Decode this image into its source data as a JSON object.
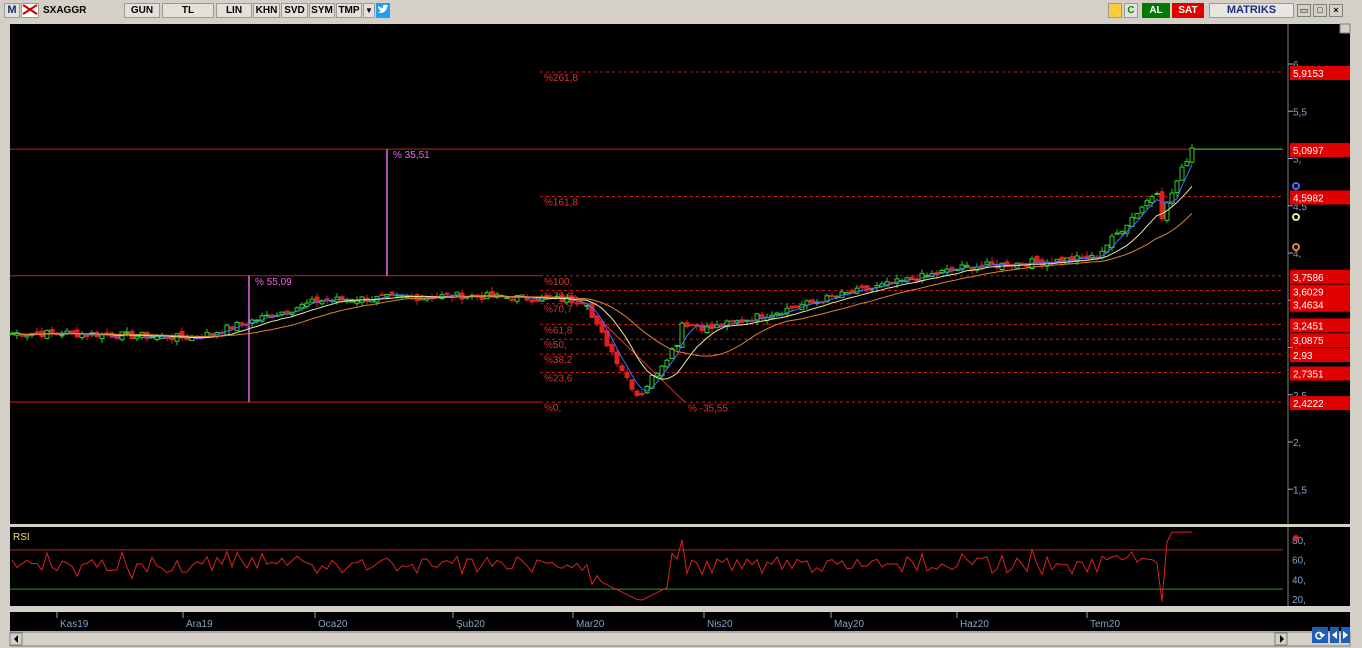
{
  "toolbar": {
    "menu_m": "M",
    "symbol": "SXAGGR",
    "period": "GUN",
    "currency": "TL",
    "scale": "LIN",
    "khn": "KHN",
    "svd": "SVD",
    "sym": "SYM",
    "tmp": "TMP",
    "buy": "AL",
    "sell": "SAT",
    "brand": "MATRIKS",
    "colors": {
      "buy": "#007a00",
      "sell": "#e00000",
      "twitter": "#1da1f2"
    }
  },
  "price_axis": {
    "ticks": [
      "6,",
      "5,5",
      "5,",
      "4,5",
      "4,",
      "3,5",
      "3,",
      "2,5",
      "2,",
      "1,5"
    ]
  },
  "price_tags": [
    "5,9153",
    "5,0997",
    "4,5982",
    "3,7586",
    "3,6029",
    "3,4634",
    "3,2451",
    "3,0875",
    "2,93",
    "2,7351",
    "2,4222"
  ],
  "fib_labels": [
    "%261,8",
    "%161,8",
    "%100,",
    "%78,6",
    "%70,7",
    "%61,8",
    "%50,",
    "%38,2",
    "%23,6",
    "%0,"
  ],
  "measures": {
    "rise1": "% 55,09",
    "rise2": "% 35,51",
    "drop": "% -35,55"
  },
  "rsi": {
    "label": "RSI",
    "ticks": [
      "80,",
      "60,",
      "40,",
      "20,"
    ]
  },
  "time_axis": {
    "labels": [
      "Kas19",
      "Ara19",
      "Oca20",
      "Şub20",
      "Mar20",
      "Nis20",
      "May20",
      "Haz20",
      "Tem20"
    ]
  },
  "chart_data": {
    "type": "candlestick",
    "symbol": "SXAGGR",
    "x": [
      "Kas19",
      "Ara19",
      "Oca20",
      "Şub20",
      "Mar20",
      "Nis20",
      "May20",
      "Haz20",
      "Tem20"
    ],
    "close_series": [
      {
        "period": "Kas19",
        "close": 3.15
      },
      {
        "period": "Ara19",
        "close": 3.1
      },
      {
        "period": "Oca20",
        "close": 3.5
      },
      {
        "period": "Şub20",
        "close": 3.55
      },
      {
        "period": "Mar20",
        "close": 2.55
      },
      {
        "period": "Nis20",
        "close": 3.25
      },
      {
        "period": "May20",
        "close": 3.55
      },
      {
        "period": "Haz20",
        "close": 3.85
      },
      {
        "period": "Tem20",
        "close": 5.05
      }
    ],
    "last_price": 5.0997,
    "fibonacci": [
      {
        "label": "%261,8",
        "value": 5.9153
      },
      {
        "label": "%161,8",
        "value": 4.5982
      },
      {
        "label": "%100,",
        "value": 3.7586
      },
      {
        "label": "%78,6",
        "value": 3.6029
      },
      {
        "label": "%70,7",
        "value": 3.4634
      },
      {
        "label": "%61,8",
        "value": 3.2451
      },
      {
        "label": "%50,",
        "value": 3.0875
      },
      {
        "label": "%38,2",
        "value": 2.93
      },
      {
        "label": "%23,6",
        "value": 2.7351
      },
      {
        "label": "%0,",
        "value": 2.4222
      }
    ],
    "ylim": [
      1.3,
      6.3
    ],
    "rsi_ylim": [
      10,
      90
    ]
  }
}
